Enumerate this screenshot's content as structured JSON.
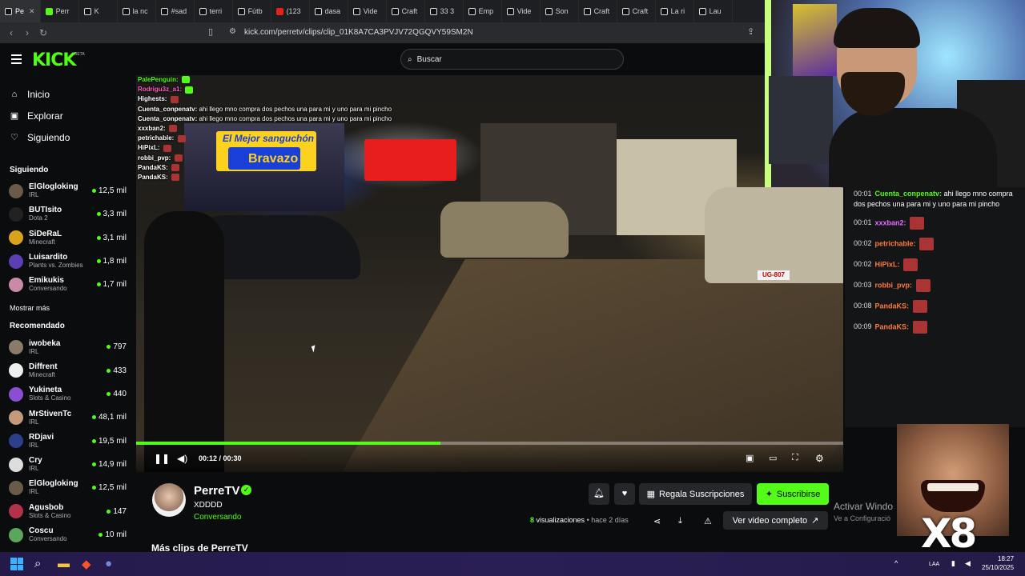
{
  "browser": {
    "tabs": [
      {
        "label": "Pe",
        "active": true
      },
      {
        "label": "Perr"
      },
      {
        "label": "K"
      },
      {
        "label": "la nc"
      },
      {
        "label": "#sad"
      },
      {
        "label": "terri"
      },
      {
        "label": "Fútb"
      },
      {
        "label": "(123"
      },
      {
        "label": "dasa"
      },
      {
        "label": "Vide"
      },
      {
        "label": "Craft"
      },
      {
        "label": "33 3"
      },
      {
        "label": "Emp"
      },
      {
        "label": "Vide"
      },
      {
        "label": "Son"
      },
      {
        "label": "Craft"
      },
      {
        "label": "Craft"
      },
      {
        "label": "La ri"
      },
      {
        "label": "Lau"
      }
    ],
    "url": "kick.com/perretv/clips/clip_01K8A7CA3PVJV72QGQVY59SM2N"
  },
  "header": {
    "logo": "KICK",
    "beta": "BETA",
    "search_placeholder": "Buscar"
  },
  "sidebar": {
    "nav": [
      {
        "label": "Inicio",
        "icon": "home-icon"
      },
      {
        "label": "Explorar",
        "icon": "compass-icon"
      },
      {
        "label": "Siguiendo",
        "icon": "heart-icon"
      }
    ],
    "following_title": "Siguiendo",
    "following": [
      {
        "name": "ElGlogloking",
        "category": "IRL",
        "viewers": "12,5 mil",
        "color": "#6a5a4a"
      },
      {
        "name": "BUTIsito",
        "category": "Dota 2",
        "viewers": "3,3 mil",
        "color": "#222"
      },
      {
        "name": "SiDeRaL",
        "category": "Minecraft",
        "viewers": "3,1 mil",
        "color": "#d9a21a"
      },
      {
        "name": "Luisardito",
        "category": "Plants vs. Zombies",
        "viewers": "1,8 mil",
        "color": "#5b3fb3"
      },
      {
        "name": "Emikukis",
        "category": "Conversando",
        "viewers": "1,7 mil",
        "color": "#c98aa8"
      }
    ],
    "show_more": "Mostrar más",
    "recommended_title": "Recomendado",
    "recommended": [
      {
        "name": "iwobeka",
        "category": "IRL",
        "viewers": "797",
        "color": "#8a7a6a"
      },
      {
        "name": "Diffrent",
        "category": "Minecraft",
        "viewers": "433",
        "color": "#eee"
      },
      {
        "name": "Yukineta",
        "category": "Slots & Casino",
        "viewers": "440",
        "color": "#8a4fd0"
      },
      {
        "name": "MrStivenTc",
        "category": "IRL",
        "viewers": "48,1 mil",
        "color": "#c49a7a"
      },
      {
        "name": "RDjavi",
        "category": "IRL",
        "viewers": "19,5 mil",
        "color": "#2b3f8a"
      },
      {
        "name": "Cry",
        "category": "IRL",
        "viewers": "14,9 mil",
        "color": "#ddd"
      },
      {
        "name": "ElGlogloking",
        "category": "IRL",
        "viewers": "12,5 mil",
        "color": "#6a5a4a"
      },
      {
        "name": "Agusbob",
        "category": "Slots & Casino",
        "viewers": "147",
        "color": "#b3324a"
      },
      {
        "name": "Coscu",
        "category": "Conversando",
        "viewers": "10 mil",
        "color": "#5aa65a"
      }
    ]
  },
  "video": {
    "overlay_chat": [
      {
        "user": "PalePenguin:",
        "text": "",
        "color": "#53fc18"
      },
      {
        "user": "Rodrigu3z_a1:",
        "text": "",
        "color": "#ff5ec4"
      },
      {
        "user": "Highests:",
        "text": "",
        "color": "#ffffff"
      },
      {
        "user": "Cuenta_conpenatv:",
        "text": "ahi llego mno compra dos pechos una para mi y uno para mi pincho",
        "color": "#ffffff"
      },
      {
        "user": "Cuenta_conpenatv:",
        "text": "ahi llego mno compra dos pechos una para mi y uno para mi pincho",
        "color": "#ffffff"
      },
      {
        "user": "xxxban2:",
        "text": "",
        "color": "#ffffff"
      },
      {
        "user": "petrichable:",
        "text": "",
        "color": "#ffffff"
      },
      {
        "user": "HiPixL:",
        "text": "",
        "color": "#ffffff"
      },
      {
        "user": "robbi_pvp:",
        "text": "",
        "color": "#ffffff"
      },
      {
        "user": "PandaKS:",
        "text": "",
        "color": "#ffffff"
      },
      {
        "user": "PandaKS:",
        "text": "",
        "color": "#ffffff"
      }
    ],
    "store_sign_1": "El Mejor sanguchón",
    "store_sign_2": "Bravazo",
    "time": "00:12 / 00:30",
    "progress": 0.43,
    "plate": "UG-807"
  },
  "stream_chat": [
    {
      "time": "00:01",
      "user": "Cuenta_conpenatv:",
      "text": "ahi llego mno compra dos pechos una para mi y uno para mi pincho",
      "color": "#53fc18"
    },
    {
      "time": "00:01",
      "user": "xxxban2:",
      "text": "",
      "color": "#e66bff"
    },
    {
      "time": "00:02",
      "user": "petrichable:",
      "text": "",
      "color": "#ff7a3d"
    },
    {
      "time": "00:02",
      "user": "HiPixL:",
      "text": "",
      "color": "#ff7a3d"
    },
    {
      "time": "00:03",
      "user": "robbi_pvp:",
      "text": "",
      "color": "#ff7a3d"
    },
    {
      "time": "00:08",
      "user": "PandaKS:",
      "text": "",
      "color": "#ff7a3d"
    },
    {
      "time": "00:09",
      "user": "PandaKS:",
      "text": "",
      "color": "#ff7a3d"
    }
  ],
  "channel": {
    "name": "PerreTV",
    "clip_title": "XDDDD",
    "category": "Conversando",
    "gift_label": "Regala Suscripciones",
    "subscribe_label": "Suscribirse",
    "views_count": "8",
    "views_label": "visualizaciones",
    "age": "hace 2 días",
    "full_video_label": "Ver video completo",
    "more_clips": "Más clips de PerreTV"
  },
  "watermark": {
    "line1": "Activar Windo",
    "line2": "Ve a Configuració"
  },
  "meme_text": "X8",
  "taskbar": {
    "language": "LAA",
    "time": "18:27",
    "date": "25/10/2025"
  }
}
